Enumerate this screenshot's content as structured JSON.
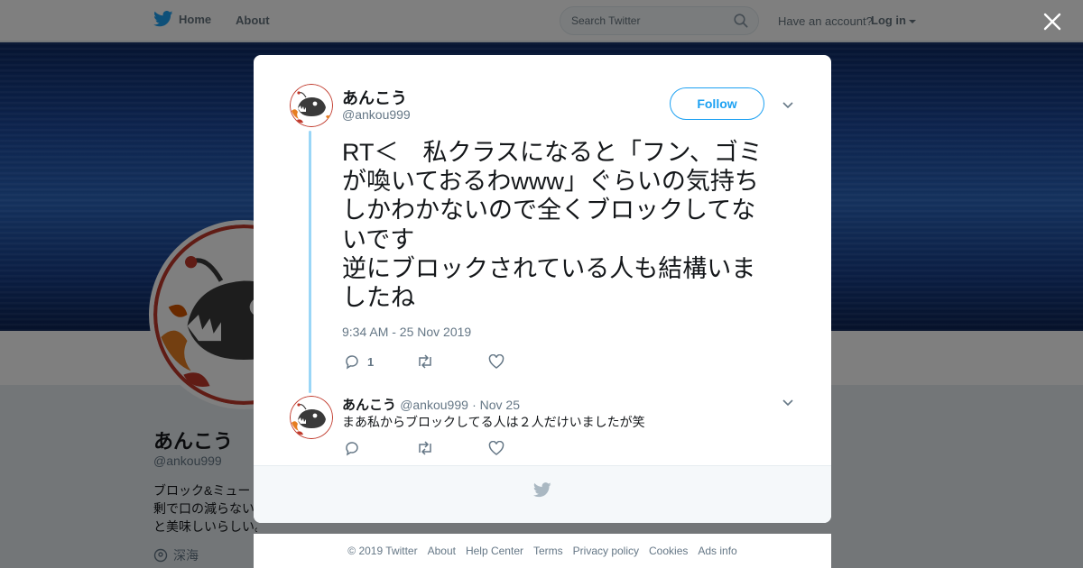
{
  "nav": {
    "home_label": "Home",
    "about_label": "About",
    "search_placeholder": "Search Twitter",
    "account_prompt": "Have an account?",
    "login_label": "Log in"
  },
  "profile": {
    "name": "あんこう",
    "handle": "@ankou999",
    "bio_lines": [
      "ブロック&ミュー",
      "剰で口の減らない",
      "と美味しいらしい。"
    ],
    "location": "深海"
  },
  "tweet": {
    "author_name": "あんこう",
    "author_handle": "@ankou999",
    "follow_label": "Follow",
    "text_lines": [
      "RT＜　私クラスになると「フン、ゴミ",
      "が喚いておるわwww」ぐらいの気持ち",
      "しかわかないので全くブロックしてな",
      "いです",
      "逆にブロックされている人も結構いま",
      "したね"
    ],
    "timestamp": "9:34 AM - 25 Nov 2019",
    "reply_count": "1"
  },
  "reply": {
    "author_name": "あんこう",
    "author_handle": "@ankou999",
    "date": "· Nov 25",
    "text": "まあ私からブロックしてる人は２人だけいましたが笑"
  },
  "footer": {
    "links": [
      "© 2019 Twitter",
      "About",
      "Help Center",
      "Terms",
      "Privacy policy",
      "Cookies",
      "Ads info"
    ]
  },
  "colors": {
    "twitter_blue": "#1da1f2",
    "thread_line": "#9ad6f7",
    "secondary_text": "#657786"
  }
}
